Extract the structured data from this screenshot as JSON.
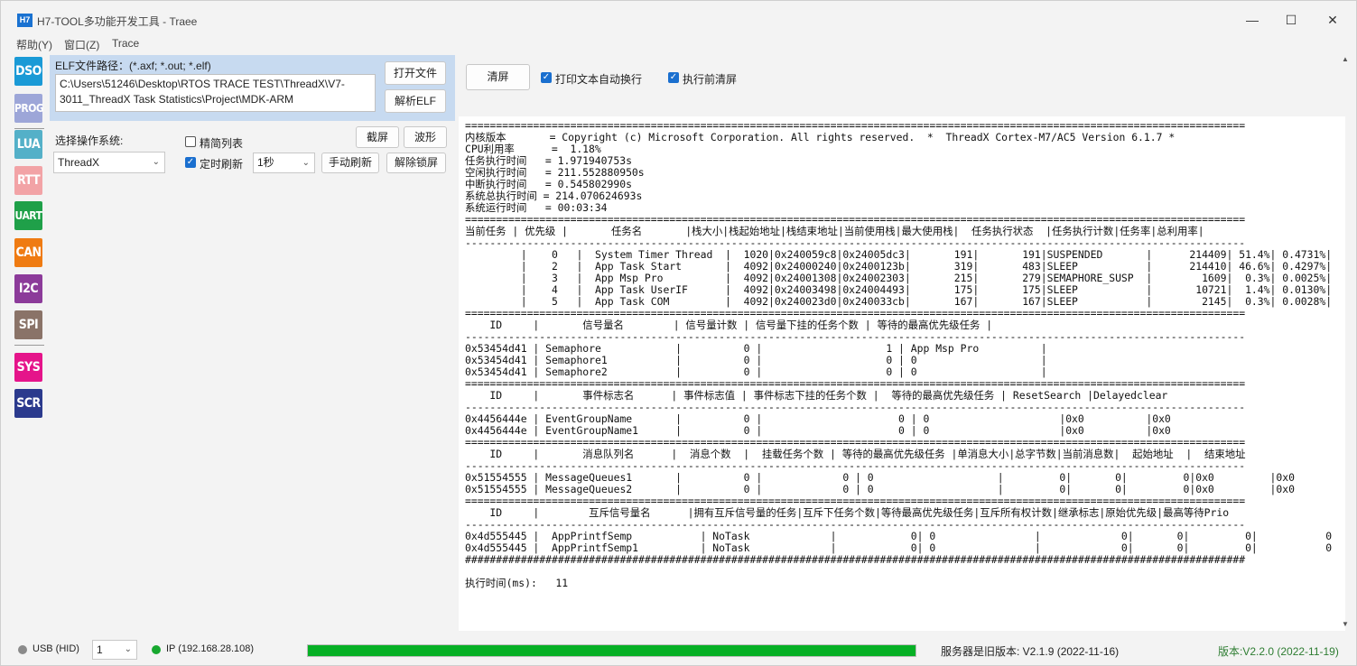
{
  "window": {
    "icon_text": "H7",
    "title": "H7-TOOL多功能开发工具 - Traee",
    "minimize": "—",
    "maximize": "☐",
    "close": "✕"
  },
  "menu": [
    "帮助(Y)",
    "窗口(Z)",
    "Trace"
  ],
  "sidebar": [
    "DSO",
    "PROG",
    "LUA",
    "RTT",
    "UART",
    "CAN",
    "I2C",
    "SPI",
    "SYS",
    "SCR"
  ],
  "colors": {
    "dso": "#1a9ad6",
    "prog": "#9da6d8",
    "lua": "#54b0c8",
    "rtt": "#f2a3a6",
    "uart": "#1fa049",
    "can": "#ef7b12",
    "i2c": "#8c3b9a",
    "spi": "#8a7368",
    "sys": "#e5148a",
    "scr": "#2b3a8d",
    "progress": "#06b025",
    "version": "#2e7d32"
  },
  "elf": {
    "label": "ELF文件路径：(*.axf; *.out; *.elf)",
    "path_line1": "C:\\Users\\51246\\Desktop\\RTOS TRACE TEST\\ThreadX\\V7-",
    "path_line2": "3011_ThreadX Task Statistics\\Project\\MDK-ARM",
    "open_button": "打开文件",
    "parse_button": "解析ELF"
  },
  "controls": {
    "os_label": "选择操作系统:",
    "os_value": "ThreadX",
    "simple_list_label": "精简列表",
    "timed_refresh_label": "定时刷新",
    "interval_value": "1秒",
    "screenshot_button": "截屏",
    "waveform_button": "波形",
    "manual_refresh_button": "手动刷新",
    "unlock_button": "解除锁屏"
  },
  "toolbar": {
    "clear_button": "清屏",
    "wrap_label": "打印文本自动换行",
    "clear_before_label": "执行前清屏"
  },
  "output_text": "==============================================================================================================================\n内核版本       = Copyright (c) Microsoft Corporation. All rights reserved.  *  ThreadX Cortex-M7/AC5 Version 6.1.7 *\nCPU利用率      =  1.18%\n任务执行时间   = 1.971940753s\n空闲执行时间   = 211.552880950s\n中断执行时间   = 0.545802990s\n系统总执行时间 = 214.070624693s\n系统运行时间   = 00:03:34\n==============================================================================================================================\n当前任务 | 优先级 |       任务名       |栈大小|栈起始地址|栈结束地址|当前使用栈|最大使用栈|  任务执行状态  |任务执行计数|任务率|总利用率|\n------------------------------------------------------------------------------------------------------------------------------\n         |    0   |  System Timer Thread  |  1020|0x240059c8|0x24005dc3|       191|       191|SUSPENDED       |      214409| 51.4%| 0.4731%|\n         |    2   |  App Task Start       |  4092|0x24000240|0x2400123b|       319|       483|SLEEP           |      214410| 46.6%| 0.4297%|\n         |    3   |  App Msp Pro          |  4092|0x24001308|0x24002303|       215|       279|SEMAPHORE_SUSP  |        1609|  0.3%| 0.0025%|\n         |    4   |  App Task UserIF      |  4092|0x24003498|0x24004493|       175|       175|SLEEP           |       10721|  1.4%| 0.0130%|\n         |    5   |  App Task COM         |  4092|0x240023d0|0x240033cb|       167|       167|SLEEP           |        2145|  0.3%| 0.0028%|\n==============================================================================================================================\n    ID     |       信号量名        | 信号量计数 | 信号量下挂的任务个数 | 等待的最高优先级任务 |\n------------------------------------------------------------------------------------------------------------------------------\n0x53454d41 | Semaphore            |          0 |                    1 | App Msp Pro          |\n0x53454d41 | Semaphore1           |          0 |                    0 | 0                    |\n0x53454d41 | Semaphore2           |          0 |                    0 | 0                    |\n==============================================================================================================================\n    ID     |       事件标志名      | 事件标志值 | 事件标志下挂的任务个数 |  等待的最高优先级任务 | ResetSearch |Delayedclear\n------------------------------------------------------------------------------------------------------------------------------\n0x4456444e | EventGroupName       |          0 |                      0 | 0                     |0x0          |0x0\n0x4456444e | EventGroupName1      |          0 |                      0 | 0                     |0x0          |0x0\n==============================================================================================================================\n    ID     |       消息队列名      |  消息个数  |  挂载任务个数 | 等待的最高优先级任务 |单消息大小|总字节数|当前消息数|  起始地址  |  结束地址\n------------------------------------------------------------------------------------------------------------------------------\n0x51554555 | MessageQueues1       |          0 |             0 | 0                    |         0|       0|         0|0x0         |0x0\n0x51554555 | MessageQueues2       |          0 |             0 | 0                    |         0|       0|         0|0x0         |0x0\n==============================================================================================================================\n    ID     |        互斥信号量名      |拥有互斥信号量的任务|互斥下任务个数|等待最高优先级任务|互斥所有权计数|继承标志|原始优先级|最高等待Prio\n------------------------------------------------------------------------------------------------------------------------------\n0x4d555445 |  AppPrintfSemp           | NoTask             |            0| 0                |             0|       0|         0|           0\n0x4d555445 |  AppPrintfSemp1          | NoTask             |            0| 0                |             0|       0|         0|           0\n##############################################################################################################################\n\n执行时间(ms):   11",
  "status": {
    "usb_label": "USB (HID)",
    "device_index": "1",
    "ip_label": "IP (192.168.28.108)",
    "progress_percent": 100,
    "server_version": "服务器是旧版本: V2.1.9 (2022-11-16)",
    "local_version": "版本:V2.2.0 (2022-11-19)"
  }
}
